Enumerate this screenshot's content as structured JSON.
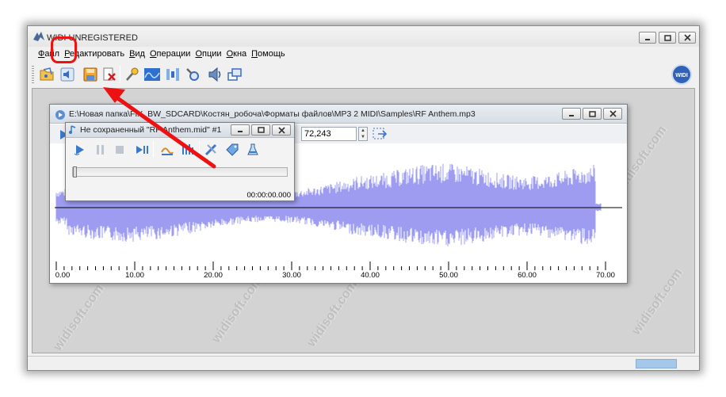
{
  "window": {
    "title": "WIDI UNREGISTERED"
  },
  "menu": {
    "items": [
      "Файл",
      "Редактировать",
      "Вид",
      "Операции",
      "Опции",
      "Окна",
      "Помощь"
    ]
  },
  "toolbar": {
    "buttons": [
      "open-file-icon",
      "play-speaker-icon",
      "save-icon",
      "close-file-icon",
      "microphone-icon",
      "spectrum-icon",
      "split-tracks-icon",
      "settings-icon",
      "speaker-icon",
      "windows-icon"
    ],
    "highlighted": "save-icon",
    "logo_text": "WIDI"
  },
  "audio_window": {
    "title": "E:\\Новая папка\\FIX_BW_SDCARD\\Костян_робоча\\Форматы файлов\\MP3 2 MIDI\\Samples\\RF Anthem.mp3",
    "position_value": "72,243",
    "axis_ticks": [
      "0.00",
      "10.00",
      "20.00",
      "30.00",
      "40.00",
      "50.00",
      "60.00",
      "70.00"
    ],
    "wave_color": "#9d9cf0"
  },
  "midi_window": {
    "title": "Не сохраненный \"RF Anthem.mid\" #1",
    "time": "00:00:00.000",
    "progress": 0
  },
  "watermark": "widisoft.com",
  "colors": {
    "annotation": "#ee1111",
    "accent": "#3a78c9",
    "waveform": "#9d9cf0"
  }
}
